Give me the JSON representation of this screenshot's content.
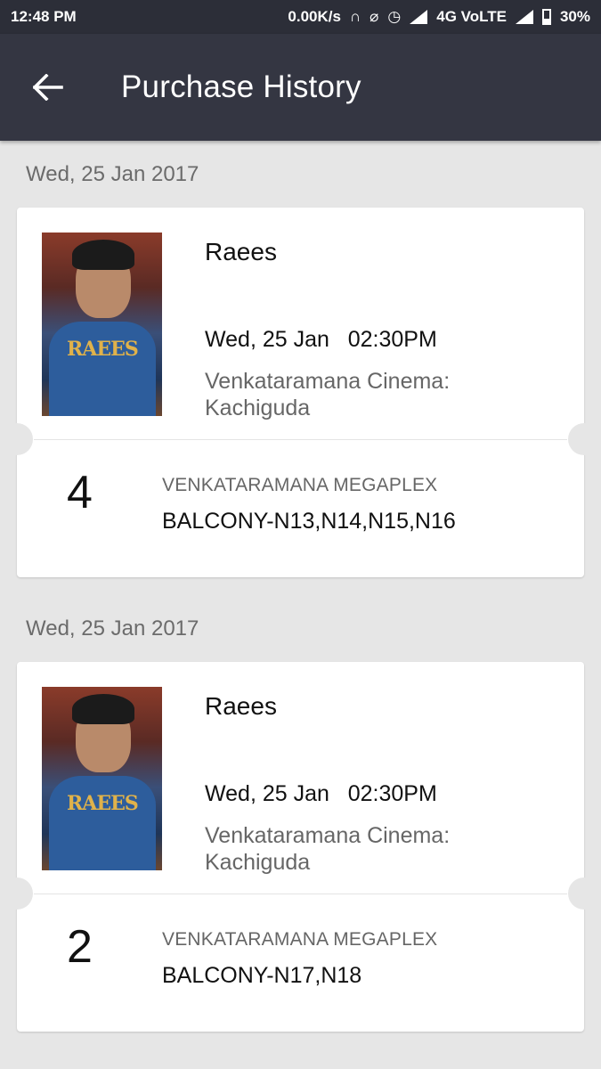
{
  "status_bar": {
    "time": "12:48 PM",
    "net_speed": "0.00K/s",
    "network": "4G VoLTE",
    "battery": "30%"
  },
  "toolbar": {
    "title": "Purchase History"
  },
  "purchases": [
    {
      "date_header": "Wed, 25 Jan 2017",
      "movie": "Raees",
      "show_time": "Wed, 25 Jan   02:30PM",
      "venue": "Venkataramana Cinema: Kachiguda",
      "ticket_count": "4",
      "cinema_name": "VENKATARAMANA MEGAPLEX",
      "seats": "BALCONY-N13,N14,N15,N16",
      "poster_logo": "RAEES"
    },
    {
      "date_header": "Wed, 25 Jan 2017",
      "movie": "Raees",
      "show_time": "Wed, 25 Jan   02:30PM",
      "venue": "Venkataramana Cinema: Kachiguda",
      "ticket_count": "2",
      "cinema_name": "VENKATARAMANA MEGAPLEX",
      "seats": "BALCONY-N17,N18",
      "poster_logo": "RAEES"
    }
  ]
}
